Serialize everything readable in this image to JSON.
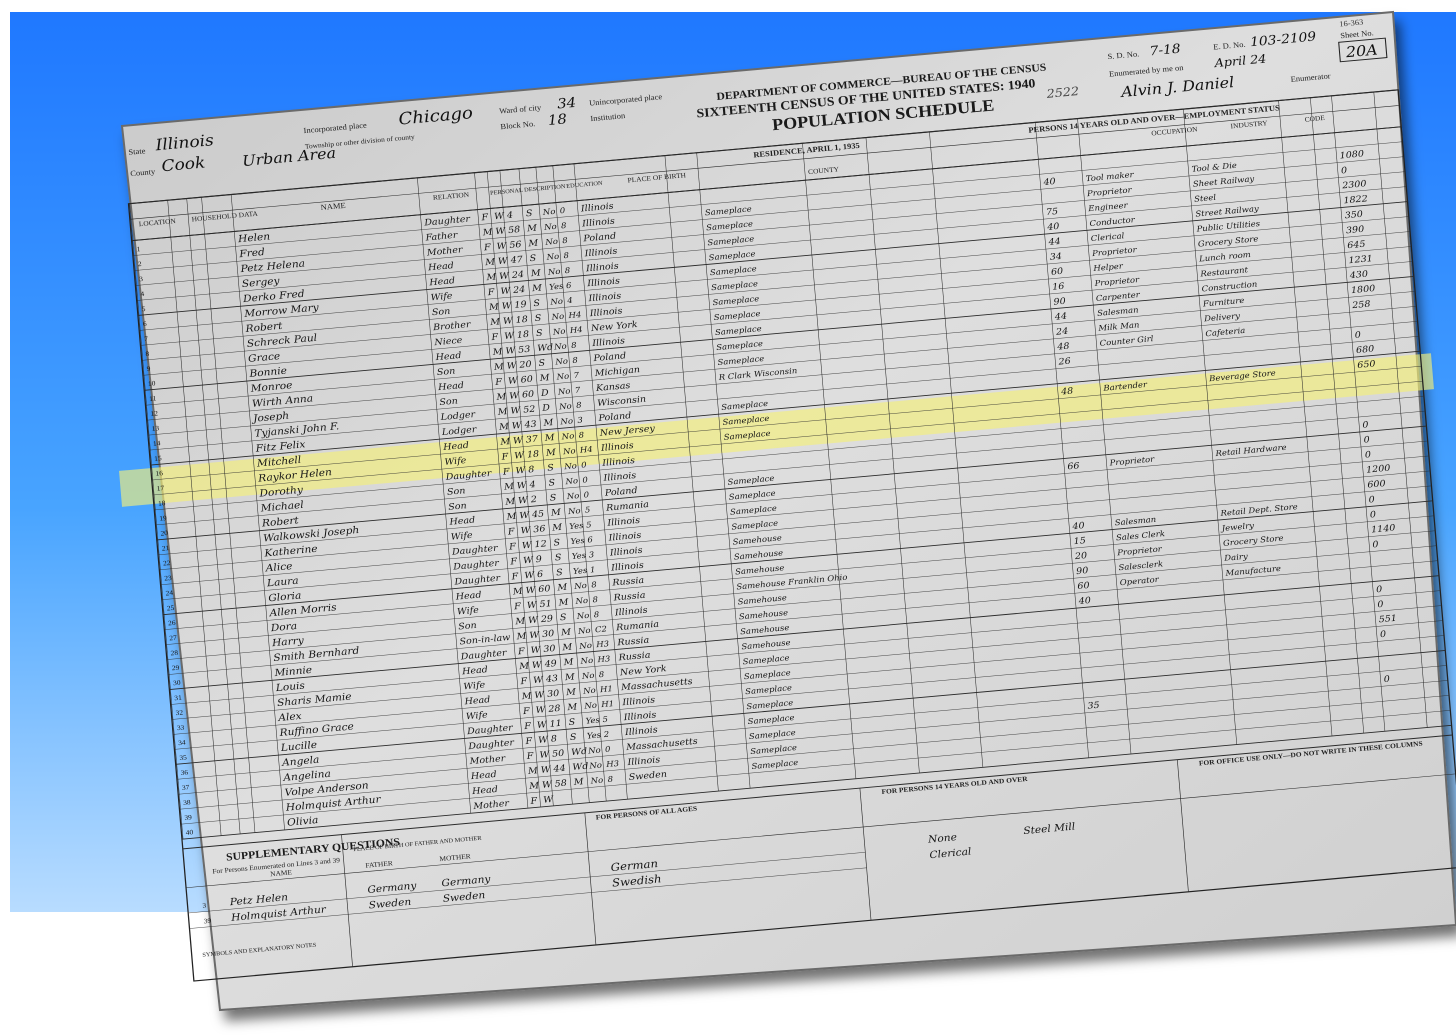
{
  "header": {
    "form_number": "16-363",
    "dept": "DEPARTMENT OF COMMERCE—BUREAU OF THE CENSUS",
    "census_title": "SIXTEENTH CENSUS OF THE UNITED STATES: 1940",
    "schedule_title": "POPULATION SCHEDULE",
    "stamp_number": "2522",
    "state_label": "State",
    "state_value": "Illinois",
    "county_label": "County",
    "county_value": "Cook",
    "incorporated_label": "Incorporated place",
    "incorporated_value": "Chicago",
    "ward_label": "Ward of city",
    "ward_value": "34",
    "block_label": "Block No.",
    "block_value": "18",
    "unincorporated_label": "Unincorporated place",
    "institution_label": "Institution",
    "township_label": "Township or other division of county",
    "area_value": "Urban Area",
    "ed_label": "E. D. No.",
    "ed_value": "103-2109",
    "sd_label": "S. D. No.",
    "sd_value": "7-18",
    "sheet_label": "Sheet No.",
    "sheet_value": "20A",
    "enumerated_label": "Enumerated by me on",
    "enumerated_value": "April 24",
    "enumerator_label": "Enumerator",
    "enumerator_value": "Alvin J. Daniel",
    "residence_header": "RESIDENCE, APRIL 1, 1935",
    "persons14_header": "PERSONS 14 YEARS OLD AND OVER—EMPLOYMENT STATUS"
  },
  "columns": {
    "location": "LOCATION",
    "household": "HOUSEHOLD DATA",
    "name": "NAME",
    "relation": "RELATION",
    "personal": "PERSONAL DESCRIPTION",
    "education": "EDUCATION",
    "birthplace": "PLACE OF BIRTH",
    "county": "COUNTY",
    "occupation": "OCCUPATION",
    "industry": "INDUSTRY",
    "code": "CODE"
  },
  "rows": [
    {
      "line": "1",
      "name": "Helen",
      "relation": "Daughter",
      "sex": "F",
      "race": "W",
      "age": "4",
      "marital": "S",
      "school": "No",
      "grade": "0",
      "birthplace": "Illinois",
      "residence": "",
      "hours": "",
      "occupation": "",
      "industry": "",
      "income": ""
    },
    {
      "line": "2",
      "name": "Fred",
      "relation": "Father",
      "sex": "M",
      "race": "W",
      "age": "58",
      "marital": "M",
      "school": "No",
      "grade": "8",
      "birthplace": "Illinois",
      "residence": "Sameplace",
      "hours": "40",
      "occupation": "Tool maker",
      "industry": "Tool & Die",
      "income": "1080"
    },
    {
      "line": "3",
      "name": "Petz  Helena",
      "relation": "Mother",
      "sex": "F",
      "race": "W",
      "age": "56",
      "marital": "M",
      "school": "No",
      "grade": "8",
      "birthplace": "Poland",
      "residence": "Sameplace",
      "hours": "",
      "occupation": "Proprietor",
      "industry": "Sheet Railway",
      "income": "0"
    },
    {
      "line": "4",
      "name": "Sergey",
      "relation": "Head",
      "sex": "M",
      "race": "W",
      "age": "47",
      "marital": "S",
      "school": "No",
      "grade": "8",
      "birthplace": "Illinois",
      "residence": "Sameplace",
      "hours": "75",
      "occupation": "Engineer",
      "industry": "Steel",
      "income": "2300"
    },
    {
      "line": "5",
      "name": "Derko  Fred",
      "relation": "Head",
      "sex": "M",
      "race": "W",
      "age": "24",
      "marital": "M",
      "school": "No",
      "grade": "8",
      "birthplace": "Illinois",
      "residence": "Sameplace",
      "hours": "40",
      "occupation": "Conductor",
      "industry": "Street Railway",
      "income": "1822"
    },
    {
      "line": "6",
      "name": "Morrow  Mary",
      "relation": "Wife",
      "sex": "F",
      "race": "W",
      "age": "24",
      "marital": "M",
      "school": "Yes",
      "grade": "6",
      "birthplace": "Illinois",
      "residence": "Sameplace",
      "hours": "44",
      "occupation": "Clerical",
      "industry": "Public Utilities",
      "income": "350"
    },
    {
      "line": "7",
      "name": "Robert",
      "relation": "Son",
      "sex": "M",
      "race": "W",
      "age": "19",
      "marital": "S",
      "school": "No",
      "grade": "4",
      "birthplace": "Illinois",
      "residence": "Sameplace",
      "hours": "34",
      "occupation": "Proprietor",
      "industry": "Grocery Store",
      "income": "390"
    },
    {
      "line": "8",
      "name": "Schreck  Paul",
      "relation": "Brother",
      "sex": "M",
      "race": "W",
      "age": "18",
      "marital": "S",
      "school": "No",
      "grade": "H4",
      "birthplace": "Illinois",
      "residence": "Sameplace",
      "hours": "60",
      "occupation": "Helper",
      "industry": "Lunch room",
      "income": "645"
    },
    {
      "line": "9",
      "name": "Grace",
      "relation": "Niece",
      "sex": "F",
      "race": "W",
      "age": "18",
      "marital": "S",
      "school": "No",
      "grade": "H4",
      "birthplace": "New York",
      "residence": "Sameplace",
      "hours": "16",
      "occupation": "Proprietor",
      "industry": "Restaurant",
      "income": "1231"
    },
    {
      "line": "10",
      "name": "Bonnie",
      "relation": "Head",
      "sex": "M",
      "race": "W",
      "age": "53",
      "marital": "Wd",
      "school": "No",
      "grade": "8",
      "birthplace": "Illinois",
      "residence": "Sameplace",
      "hours": "90",
      "occupation": "Carpenter",
      "industry": "Construction",
      "income": "430"
    },
    {
      "line": "11",
      "name": "Monroe",
      "relation": "Son",
      "sex": "M",
      "race": "W",
      "age": "20",
      "marital": "S",
      "school": "No",
      "grade": "8",
      "birthplace": "Poland",
      "residence": "Sameplace",
      "hours": "44",
      "occupation": "Salesman",
      "industry": "Furniture",
      "income": "1800"
    },
    {
      "line": "12",
      "name": "Wirth  Anna",
      "relation": "Head",
      "sex": "F",
      "race": "W",
      "age": "60",
      "marital": "M",
      "school": "No",
      "grade": "7",
      "birthplace": "Michigan",
      "residence": "Sameplace",
      "hours": "24",
      "occupation": "Milk Man",
      "industry": "Delivery",
      "income": "258"
    },
    {
      "line": "13",
      "name": "Joseph",
      "relation": "Son",
      "sex": "M",
      "race": "W",
      "age": "60",
      "marital": "D",
      "school": "No",
      "grade": "7",
      "birthplace": "Kansas",
      "residence": "R   Clark   Wisconsin",
      "hours": "48",
      "occupation": "Counter Girl",
      "industry": "Cafeteria",
      "income": ""
    },
    {
      "line": "14",
      "name": "Tyjanski  John F.",
      "relation": "Lodger",
      "sex": "M",
      "race": "W",
      "age": "52",
      "marital": "D",
      "school": "No",
      "grade": "8",
      "birthplace": "Wisconsin",
      "residence": "",
      "hours": "26",
      "occupation": "",
      "industry": "",
      "income": "0"
    },
    {
      "line": "15",
      "name": "Fitz  Felix",
      "relation": "Lodger",
      "sex": "M",
      "race": "W",
      "age": "43",
      "marital": "M",
      "school": "No",
      "grade": "3",
      "birthplace": "Poland",
      "residence": "Sameplace",
      "hours": "",
      "occupation": "",
      "industry": "",
      "income": "680"
    },
    {
      "line": "16",
      "name": "Mitchell",
      "relation": "Head",
      "sex": "M",
      "race": "W",
      "age": "37",
      "marital": "M",
      "school": "No",
      "grade": "8",
      "birthplace": "New Jersey",
      "residence": "Sameplace",
      "hours": "48",
      "occupation": "Bartender",
      "industry": "Beverage Store",
      "income": "650"
    },
    {
      "line": "17",
      "name": "Raykor  Helen",
      "relation": "Wife",
      "sex": "F",
      "race": "W",
      "age": "18",
      "marital": "M",
      "school": "No",
      "grade": "H4",
      "birthplace": "Illinois",
      "residence": "Sameplace",
      "hours": "",
      "occupation": "",
      "industry": "",
      "income": ""
    },
    {
      "line": "18",
      "name": "Dorothy",
      "relation": "Daughter",
      "sex": "F",
      "race": "W",
      "age": "8",
      "marital": "S",
      "school": "No",
      "grade": "0",
      "birthplace": "Illinois",
      "residence": "",
      "hours": "",
      "occupation": "",
      "industry": "",
      "income": ""
    },
    {
      "line": "19",
      "name": "Michael",
      "relation": "Son",
      "sex": "M",
      "race": "W",
      "age": "4",
      "marital": "S",
      "school": "No",
      "grade": "0",
      "birthplace": "Illinois",
      "residence": "",
      "hours": "",
      "occupation": "",
      "industry": "",
      "income": ""
    },
    {
      "line": "20",
      "name": "Robert",
      "relation": "Son",
      "sex": "M",
      "race": "W",
      "age": "2",
      "marital": "S",
      "school": "No",
      "grade": "0",
      "birthplace": "Poland",
      "residence": "Sameplace",
      "hours": "",
      "occupation": "",
      "industry": "",
      "income": "0"
    },
    {
      "line": "21",
      "name": "Walkowski  Joseph",
      "relation": "Head",
      "sex": "M",
      "race": "W",
      "age": "45",
      "marital": "M",
      "school": "No",
      "grade": "5",
      "birthplace": "Rumania",
      "residence": "Sameplace",
      "hours": "66",
      "occupation": "Proprietor",
      "industry": "Retail Hardware",
      "income": "0"
    },
    {
      "line": "22",
      "name": "Katherine",
      "relation": "Wife",
      "sex": "F",
      "race": "W",
      "age": "36",
      "marital": "M",
      "school": "Yes",
      "grade": "5",
      "birthplace": "Illinois",
      "residence": "Sameplace",
      "hours": "",
      "occupation": "",
      "industry": "",
      "income": "0"
    },
    {
      "line": "23",
      "name": "Alice",
      "relation": "Daughter",
      "sex": "F",
      "race": "W",
      "age": "12",
      "marital": "S",
      "school": "Yes",
      "grade": "6",
      "birthplace": "Illinois",
      "residence": "Sameplace",
      "hours": "",
      "occupation": "",
      "industry": "",
      "income": "1200"
    },
    {
      "line": "24",
      "name": "Laura",
      "relation": "Daughter",
      "sex": "F",
      "race": "W",
      "age": "9",
      "marital": "S",
      "school": "Yes",
      "grade": "3",
      "birthplace": "Illinois",
      "residence": "Samehouse",
      "hours": "",
      "occupation": "",
      "industry": "",
      "income": "600"
    },
    {
      "line": "25",
      "name": "Gloria",
      "relation": "Daughter",
      "sex": "F",
      "race": "W",
      "age": "6",
      "marital": "S",
      "school": "Yes",
      "grade": "1",
      "birthplace": "Illinois",
      "residence": "Samehouse",
      "hours": "40",
      "occupation": "Salesman",
      "industry": "Retail Dept. Store",
      "income": "0"
    },
    {
      "line": "26",
      "name": "Allen  Morris",
      "relation": "Head",
      "sex": "M",
      "race": "W",
      "age": "60",
      "marital": "M",
      "school": "No",
      "grade": "8",
      "birthplace": "Russia",
      "residence": "Samehouse",
      "hours": "15",
      "occupation": "Sales Clerk",
      "industry": "Jewelry",
      "income": "0"
    },
    {
      "line": "27",
      "name": "Dora",
      "relation": "Wife",
      "sex": "F",
      "race": "W",
      "age": "51",
      "marital": "M",
      "school": "No",
      "grade": "8",
      "birthplace": "Russia",
      "residence": "Samehouse  Franklin  Ohio",
      "hours": "20",
      "occupation": "Proprietor",
      "industry": "Grocery Store",
      "income": "1140"
    },
    {
      "line": "28",
      "name": "Harry",
      "relation": "Son",
      "sex": "M",
      "race": "W",
      "age": "29",
      "marital": "S",
      "school": "No",
      "grade": "8",
      "birthplace": "Illinois",
      "residence": "Samehouse",
      "hours": "90",
      "occupation": "Salesclerk",
      "industry": "Dairy",
      "income": "0"
    },
    {
      "line": "29",
      "name": "Smith  Bernhard",
      "relation": "Son-in-law",
      "sex": "M",
      "race": "W",
      "age": "30",
      "marital": "M",
      "school": "No",
      "grade": "C2",
      "birthplace": "Rumania",
      "residence": "Samehouse",
      "hours": "60",
      "occupation": "Operator",
      "industry": "Manufacture",
      "income": ""
    },
    {
      "line": "30",
      "name": "Minnie",
      "relation": "Daughter",
      "sex": "F",
      "race": "W",
      "age": "30",
      "marital": "M",
      "school": "No",
      "grade": "H3",
      "birthplace": "Russia",
      "residence": "Samehouse",
      "hours": "40",
      "occupation": "",
      "industry": "",
      "income": ""
    },
    {
      "line": "31",
      "name": "Louis",
      "relation": "Head",
      "sex": "M",
      "race": "W",
      "age": "49",
      "marital": "M",
      "school": "No",
      "grade": "H3",
      "birthplace": "Russia",
      "residence": "Samehouse",
      "hours": "",
      "occupation": "",
      "industry": "",
      "income": "0"
    },
    {
      "line": "32",
      "name": "Sharis  Mamie",
      "relation": "Wife",
      "sex": "F",
      "race": "W",
      "age": "43",
      "marital": "M",
      "school": "No",
      "grade": "8",
      "birthplace": "New York",
      "residence": "Sameplace",
      "hours": "",
      "occupation": "",
      "industry": "",
      "income": "0"
    },
    {
      "line": "33",
      "name": "Alex",
      "relation": "Head",
      "sex": "M",
      "race": "W",
      "age": "30",
      "marital": "M",
      "school": "No",
      "grade": "H1",
      "birthplace": "Massachusetts",
      "residence": "Sameplace",
      "hours": "",
      "occupation": "",
      "industry": "",
      "income": "551"
    },
    {
      "line": "34",
      "name": "Ruffino  Grace",
      "relation": "Wife",
      "sex": "F",
      "race": "W",
      "age": "28",
      "marital": "M",
      "school": "No",
      "grade": "H1",
      "birthplace": "Illinois",
      "residence": "Sameplace",
      "hours": "",
      "occupation": "",
      "industry": "",
      "income": "0"
    },
    {
      "line": "35",
      "name": "Lucille",
      "relation": "Daughter",
      "sex": "F",
      "race": "W",
      "age": "11",
      "marital": "S",
      "school": "Yes",
      "grade": "5",
      "birthplace": "Illinois",
      "residence": "Sameplace",
      "hours": "",
      "occupation": "",
      "industry": "",
      "income": ""
    },
    {
      "line": "36",
      "name": "Angela",
      "relation": "Daughter",
      "sex": "F",
      "race": "W",
      "age": "8",
      "marital": "S",
      "school": "Yes",
      "grade": "2",
      "birthplace": "Illinois",
      "residence": "Sameplace",
      "hours": "",
      "occupation": "",
      "industry": "",
      "income": ""
    },
    {
      "line": "37",
      "name": "Angelina",
      "relation": "Mother",
      "sex": "F",
      "race": "W",
      "age": "50",
      "marital": "Wd",
      "school": "No",
      "grade": "0",
      "birthplace": "Massachusetts",
      "residence": "Sameplace",
      "hours": "35",
      "occupation": "",
      "industry": "",
      "income": "0"
    },
    {
      "line": "38",
      "name": "Volpe  Anderson",
      "relation": "Head",
      "sex": "M",
      "race": "W",
      "age": "44",
      "marital": "Wd",
      "school": "No",
      "grade": "H3",
      "birthplace": "Illinois",
      "residence": "Sameplace",
      "hours": "",
      "occupation": "",
      "industry": "",
      "income": ""
    },
    {
      "line": "39",
      "name": "Holmquist  Arthur",
      "relation": "Head",
      "sex": "M",
      "race": "W",
      "age": "58",
      "marital": "M",
      "school": "No",
      "grade": "8",
      "birthplace": "Sweden",
      "residence": "Sameplace",
      "hours": "",
      "occupation": "",
      "industry": "",
      "income": ""
    },
    {
      "line": "40",
      "name": "Olivia",
      "relation": "Mother",
      "sex": "F",
      "race": "W",
      "age": "",
      "marital": "",
      "school": "",
      "grade": "",
      "birthplace": "",
      "residence": "",
      "hours": "",
      "occupation": "",
      "industry": "",
      "income": ""
    }
  ],
  "supplementary": {
    "title": "SUPPLEMENTARY QUESTIONS",
    "subtitle": "For Persons Enumerated on Lines 3 and 39",
    "name_col": "NAME",
    "father_col": "FATHER",
    "mother_col": "MOTHER",
    "place_of_birth_header": "PLACE OF BIRTH OF FATHER AND MOTHER",
    "for_all_ages": "FOR PERSONS OF ALL AGES",
    "for_14_over": "FOR PERSONS 14 YEARS OLD AND OVER",
    "office_use": "FOR OFFICE USE ONLY—DO NOT WRITE IN THESE COLUMNS",
    "symbols": "SYMBOLS AND EXPLANATORY NOTES",
    "people": [
      {
        "line": "3",
        "name": "Petz  Helen",
        "father": "Germany",
        "mother": "Germany",
        "language": "German",
        "occupation": "None",
        "industry": "Steel Mill"
      },
      {
        "line": "39",
        "name": "Holmquist  Arthur",
        "father": "Sweden",
        "mother": "Sweden",
        "language": "Swedish",
        "occupation": "Clerical",
        "industry": ""
      }
    ]
  },
  "colors": {
    "background_top": "#1f78ff",
    "background_bottom": "#b8dcff",
    "paper": "#d4d4d4",
    "ink": "#1a1a1a",
    "highlight": "#f4ef7a"
  }
}
